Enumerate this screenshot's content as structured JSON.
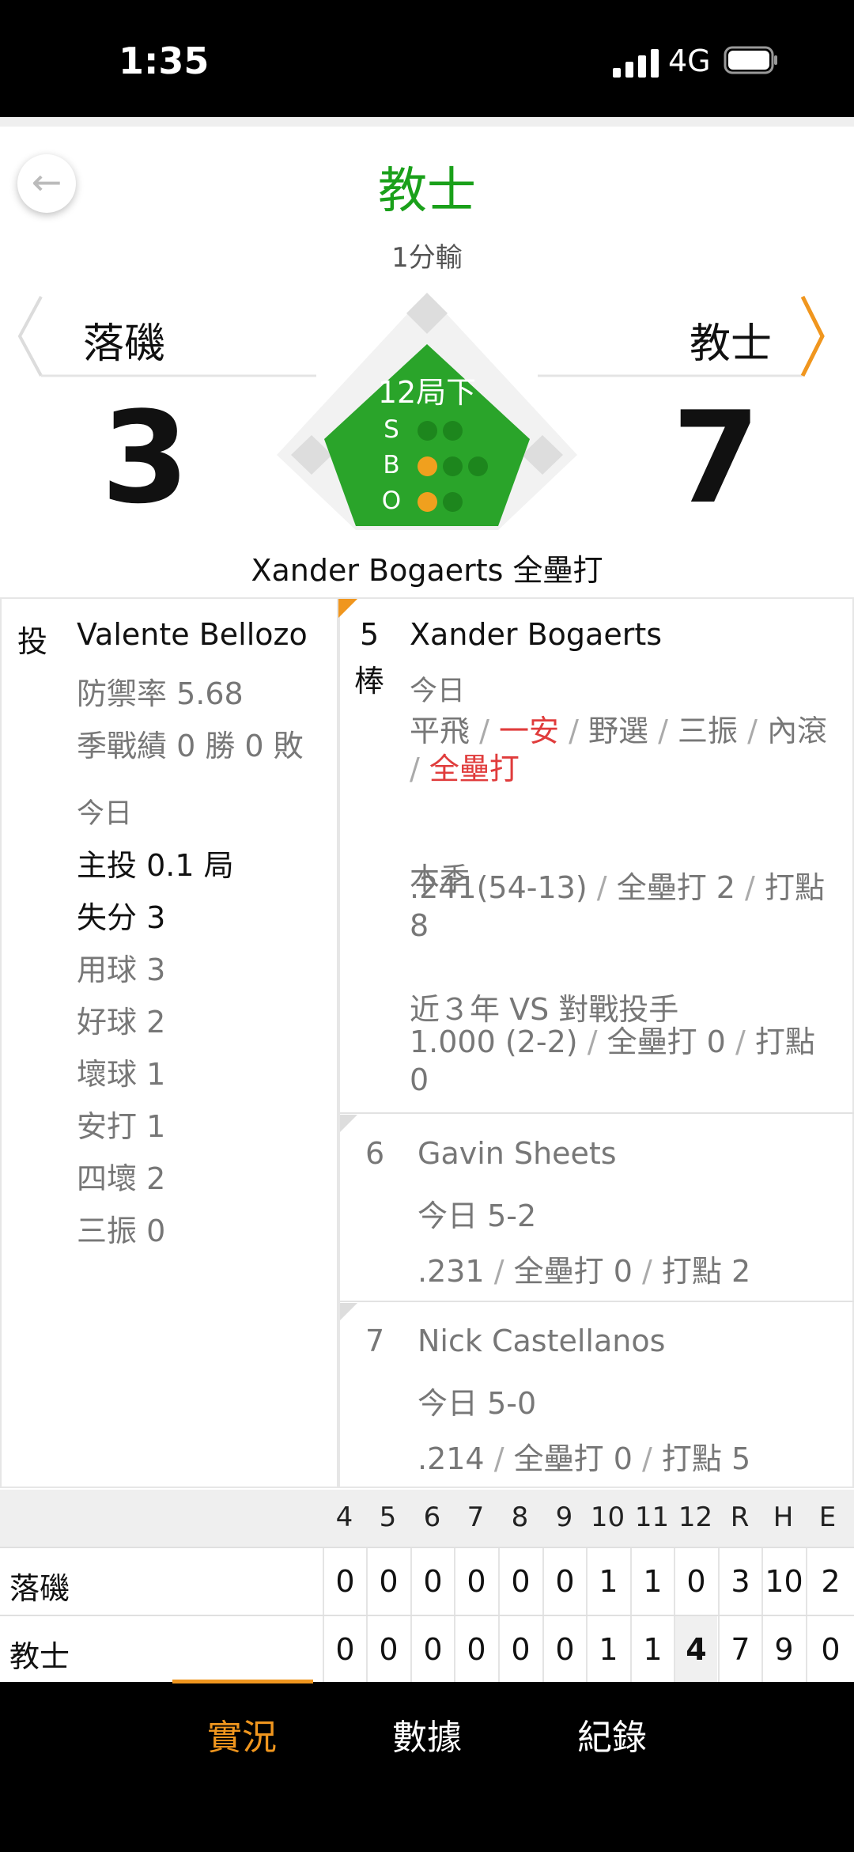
{
  "status_bar": {
    "time": "1:35",
    "network": "4G"
  },
  "header": {
    "title": "教士",
    "result": "1分輸"
  },
  "teams": {
    "away": {
      "name": "落磯",
      "score": "3"
    },
    "home": {
      "name": "教士",
      "score": "7"
    }
  },
  "diamond": {
    "inning": "12局下",
    "labels": {
      "s": "S",
      "b": "B",
      "o": "O"
    },
    "strikes": 0,
    "balls": 1,
    "outs": 1
  },
  "last_play": "Xander Bogaerts 全壘打",
  "pitcher": {
    "pos_label": "投",
    "name": "Valente Bellozo",
    "era": "防禦率 5.68",
    "record": "季戰績 0 勝 0 敗",
    "today_label": "今日",
    "stats": [
      "主投 0.1 局",
      "失分 3",
      "用球 3",
      "好球 2",
      "壞球 1",
      "安打 1",
      "四壞 2",
      "三振 0"
    ]
  },
  "batter": {
    "order": "5",
    "order_suffix": "棒",
    "name": "Xander Bogaerts",
    "today_label": "今日",
    "today_results": [
      "平飛",
      "一安",
      "野選",
      "三振",
      "內滾",
      "全壘打"
    ],
    "season_label": "本季",
    "season_avg": ".241(54-13)",
    "season_hr": "全壘打 2",
    "season_rbi": "打點 8",
    "vs_label": "近３年 VS 對戰投手",
    "vs_avg": "1.000 (2-2)",
    "vs_hr": "全壘打 0",
    "vs_rbi": "打點 0"
  },
  "on_deck": [
    {
      "order": "6",
      "name": "Gavin Sheets",
      "today": "今日 5-2",
      "avg": ".231",
      "hr": "全壘打 0",
      "rbi": "打點 2"
    },
    {
      "order": "7",
      "name": "Nick Castellanos",
      "today": "今日 5-0",
      "avg": ".214",
      "hr": "全壘打 0",
      "rbi": "打點 5"
    }
  ],
  "linescore": {
    "headers": [
      "4",
      "5",
      "6",
      "7",
      "8",
      "9",
      "10",
      "11",
      "12",
      "R",
      "H",
      "E"
    ],
    "rows": [
      {
        "team": "落磯",
        "cells": [
          "0",
          "0",
          "0",
          "0",
          "0",
          "0",
          "1",
          "1",
          "0",
          "3",
          "10",
          "2"
        ]
      },
      {
        "team": "教士",
        "cells": [
          "0",
          "0",
          "0",
          "0",
          "0",
          "0",
          "1",
          "1",
          "4",
          "7",
          "9",
          "0"
        ]
      }
    ]
  },
  "nav": {
    "tabs": [
      "實況",
      "數據",
      "紀錄"
    ]
  },
  "colors": {
    "accent_green": "#1aa01a",
    "field_green": "#2aa42a",
    "nav_orange": "#f0961e",
    "hit_red": "#e03c3c"
  }
}
